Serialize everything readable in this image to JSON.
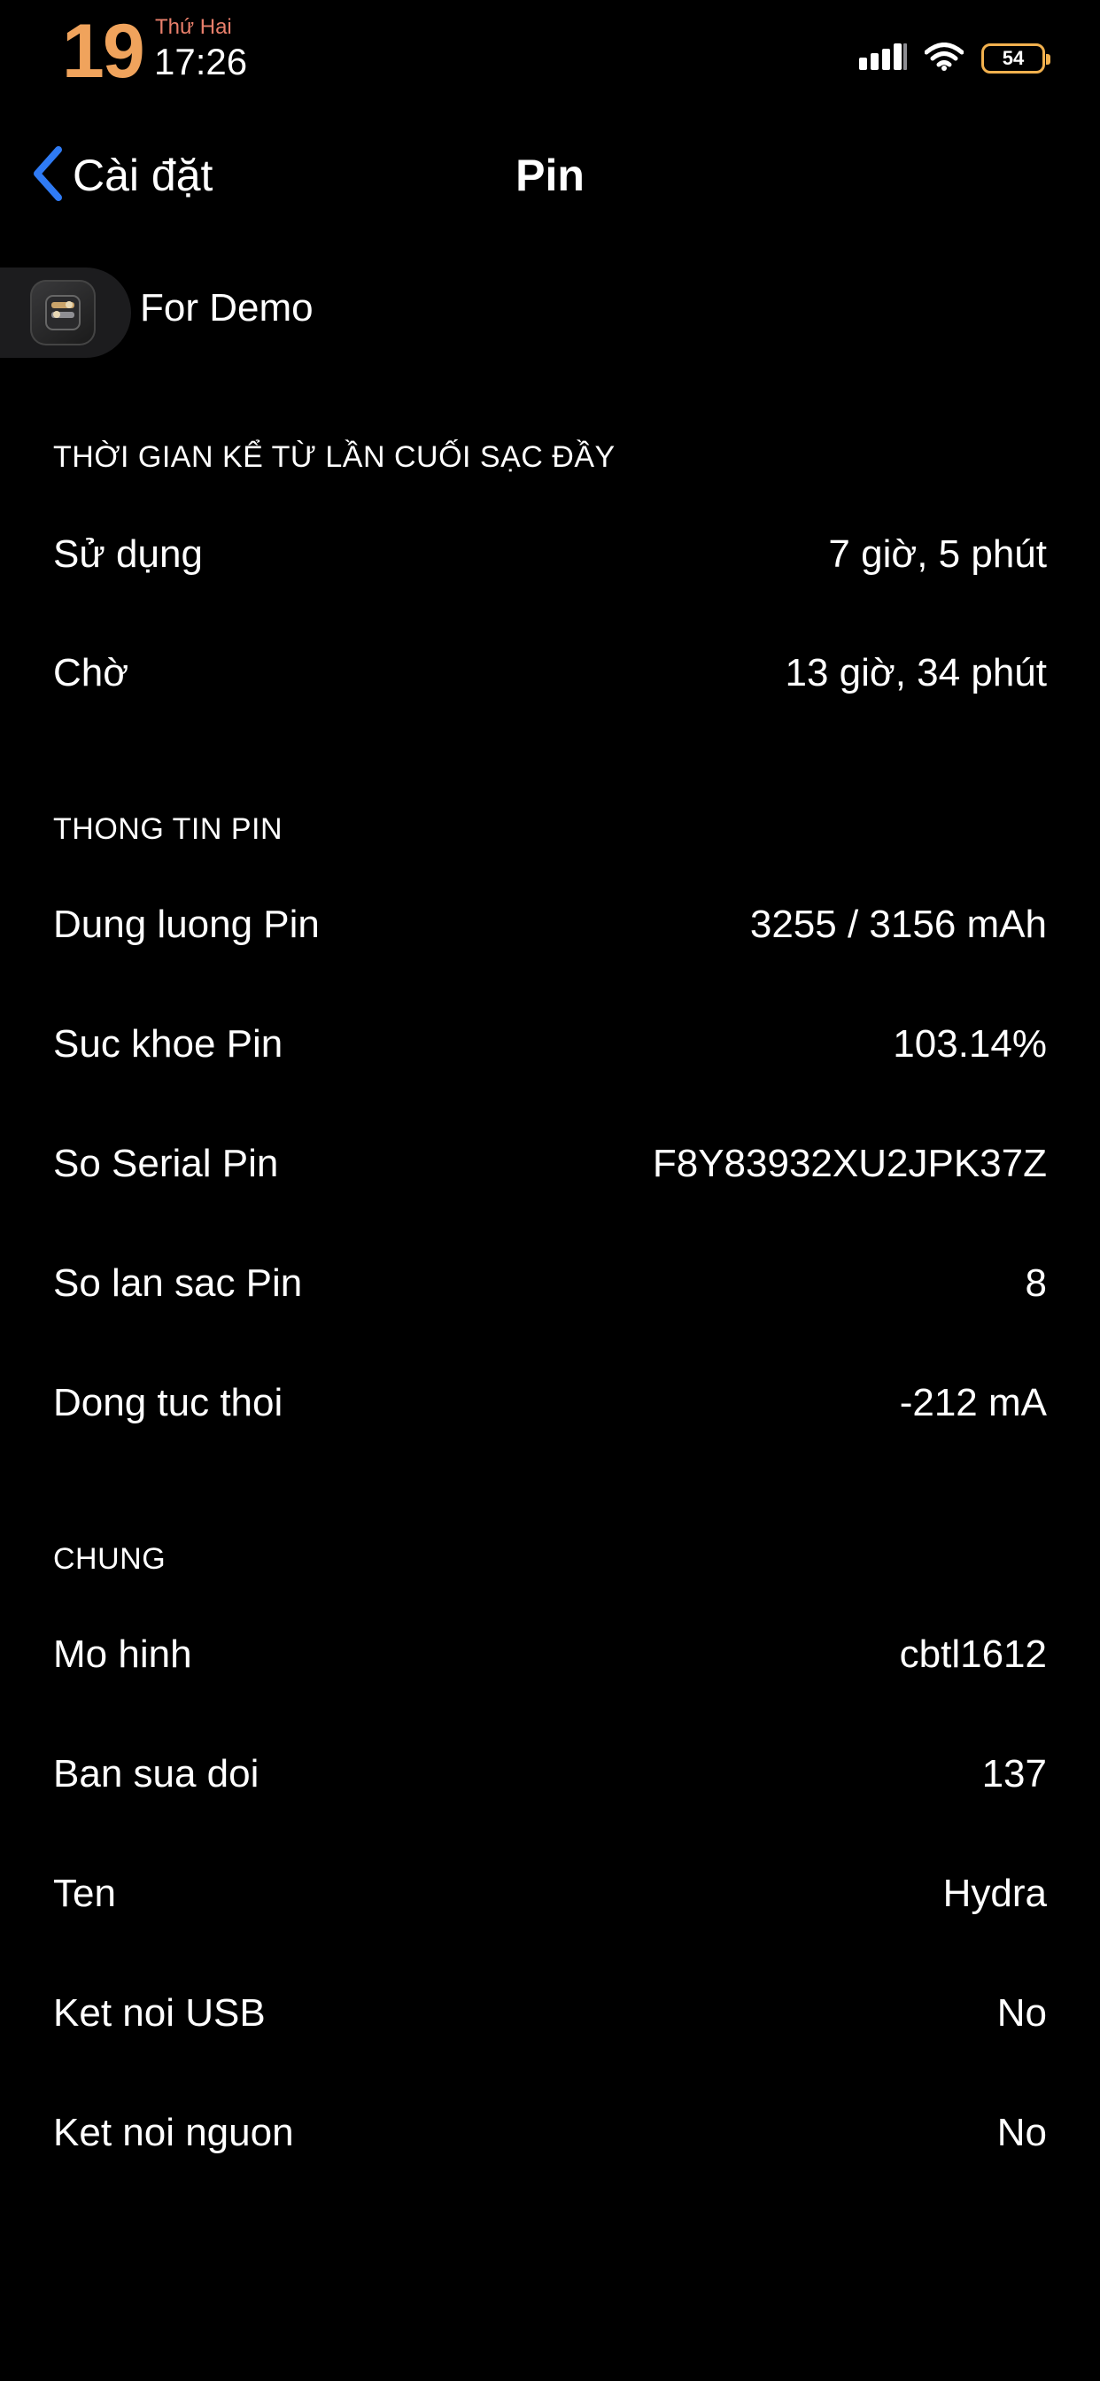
{
  "status_bar": {
    "day": "19",
    "weekday": "Thứ Hai",
    "time": "17:26",
    "battery_level": "54",
    "signal_icon": "cellular-signal-icon",
    "wifi_icon": "wifi-icon",
    "battery_color": "#f2b14e"
  },
  "nav": {
    "back_label": "Cài đặt",
    "title": "Pin",
    "accent": "#2f7bf5"
  },
  "demo": {
    "label": "For Demo",
    "icon": "demo-app-icon"
  },
  "sections": [
    {
      "header": "THỜI GIAN KỂ TỪ LẦN CUỐI SẠC ĐẦY",
      "rows": [
        {
          "label": "Sử dụng",
          "value": "7 giờ, 5 phút"
        },
        {
          "label": "Chờ",
          "value": "13 giờ, 34 phút"
        }
      ]
    },
    {
      "header": "THONG TIN PIN",
      "rows": [
        {
          "label": "Dung luong Pin",
          "value": "3255 / 3156 mAh"
        },
        {
          "label": "Suc khoe Pin",
          "value": "103.14%"
        },
        {
          "label": "So Serial Pin",
          "value": "F8Y83932XU2JPK37Z"
        },
        {
          "label": "So lan sac Pin",
          "value": "8"
        },
        {
          "label": "Dong tuc thoi",
          "value": "-212 mA"
        }
      ]
    },
    {
      "header": "CHUNG",
      "rows": [
        {
          "label": "Mo hinh",
          "value": "cbtl1612"
        },
        {
          "label": "Ban sua doi",
          "value": "137"
        },
        {
          "label": "Ten",
          "value": "Hydra"
        },
        {
          "label": "Ket noi USB",
          "value": "No"
        },
        {
          "label": "Ket noi nguon",
          "value": "No"
        }
      ]
    }
  ]
}
